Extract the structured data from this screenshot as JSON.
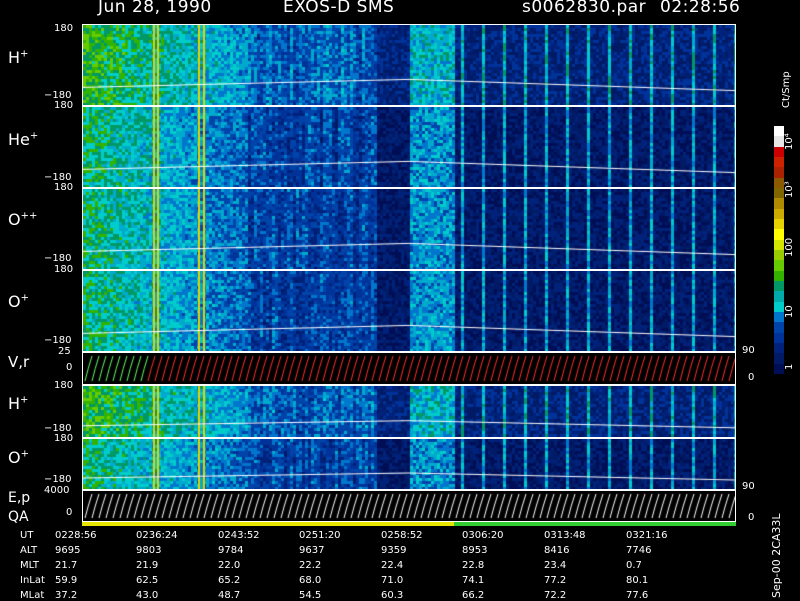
{
  "header": {
    "date": "Jun 28, 1990",
    "instrument": "EXOS-D SMS",
    "file": "s0062830.par",
    "time": "02:28:56"
  },
  "panels": [
    {
      "species": "H",
      "charge": "+",
      "top": "180",
      "bottom": "−180"
    },
    {
      "species": "He",
      "charge": "+",
      "top": "180",
      "bottom": "−180"
    },
    {
      "species": "O",
      "charge": "++",
      "top": "180",
      "bottom": "−180"
    },
    {
      "species": "O",
      "charge": "+",
      "top": "180",
      "bottom": "−180"
    }
  ],
  "vr_panel": {
    "label": "V,r",
    "top": "25",
    "mid": "0",
    "right_top": "90",
    "right_bottom": "0"
  },
  "lower_panels": [
    {
      "species": "H",
      "charge": "+",
      "top": "180",
      "bottom": "−180"
    },
    {
      "species": "O",
      "charge": "+",
      "top": "180",
      "bottom": "−180"
    }
  ],
  "ep_panel": {
    "label1": "E,p",
    "label2": "QA",
    "top": "4000",
    "mid": "0",
    "right_top": "90",
    "right_bottom": "0"
  },
  "colorbar": {
    "unit": "Ct/Smp",
    "ticks": [
      "10⁴",
      "10³",
      "100",
      "10",
      "1"
    ],
    "colors": [
      "#ffffff",
      "#e6e6e6",
      "#cc0000",
      "#cc2200",
      "#aa2200",
      "#8b5a00",
      "#806600",
      "#b08a00",
      "#ccaa00",
      "#e6d200",
      "#ffff00",
      "#d4e600",
      "#99cc00",
      "#66cc00",
      "#33b300",
      "#009966",
      "#00aaaa",
      "#00cccc",
      "#0077cc",
      "#0044aa",
      "#003399",
      "#00227a",
      "#001a66",
      "#000e55"
    ]
  },
  "footer": {
    "rows": [
      {
        "label": "UT",
        "values": [
          "0228:56",
          "0236:24",
          "0243:52",
          "0251:20",
          "0258:52",
          "0306:20",
          "0313:48",
          "0321:16"
        ]
      },
      {
        "label": "ALT",
        "values": [
          "9695",
          "9803",
          "9784",
          "9637",
          "9359",
          "8953",
          "8416",
          "7746"
        ]
      },
      {
        "label": "MLT",
        "values": [
          "21.7",
          "21.9",
          "22.0",
          "22.2",
          "22.4",
          "22.8",
          "23.4",
          "0.7"
        ]
      },
      {
        "label": "InLat",
        "values": [
          "59.9",
          "62.5",
          "65.2",
          "68.0",
          "71.0",
          "74.1",
          "77.2",
          "80.1"
        ]
      },
      {
        "label": "MLat",
        "values": [
          "37.2",
          "43.0",
          "48.7",
          "54.5",
          "60.3",
          "66.2",
          "72.2",
          "77.6"
        ]
      }
    ],
    "side_label": "Sep-00  2CA33L"
  },
  "chart_data": {
    "type": "heatmap",
    "title": "Jun 28, 1990   EXOS-D SMS",
    "x_tick_labels": [
      "0228:56",
      "0236:24",
      "0243:52",
      "0251:20",
      "0258:52",
      "0306:20",
      "0313:48",
      "0321:16"
    ],
    "panels": [
      "H+",
      "He+",
      "O++",
      "O+",
      "V,r",
      "H+",
      "O+",
      "E,p / QA"
    ],
    "colorbar_label": "Ct/Smp",
    "colorbar_ticks": [
      "1",
      "10",
      "100",
      "10³",
      "10⁴"
    ]
  }
}
